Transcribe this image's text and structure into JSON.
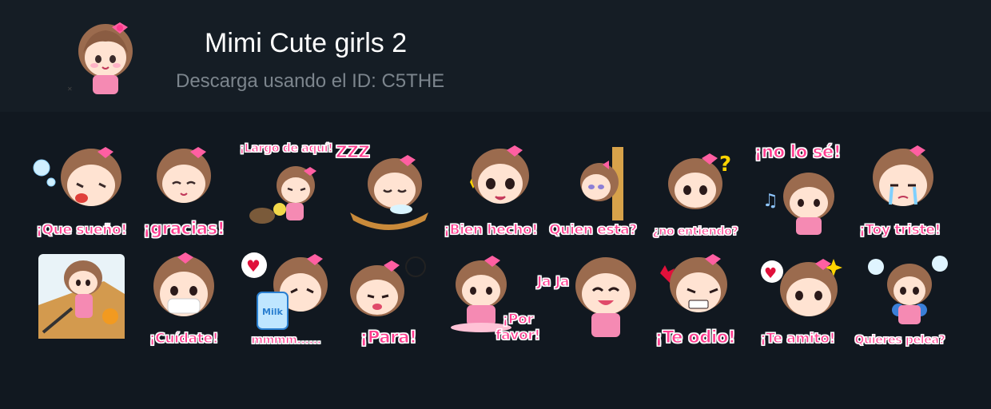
{
  "header": {
    "title": "Mimi Cute girls 2",
    "subtitle": "Descarga usando el ID: C5THE"
  },
  "colors": {
    "background": "#111820",
    "header_background": "#151d25",
    "title": "#ffffff",
    "subtitle": "#7c858d",
    "caption": "#ff3b8e",
    "hair": "#9b6b4e",
    "bow": "#ff5fa2",
    "apron": "#f58ab3"
  },
  "stickers": [
    {
      "caption": "¡Que sueño!"
    },
    {
      "caption": "¡gracias!"
    },
    {
      "caption": "¡Largo de aquí!"
    },
    {
      "caption": "ZZZ"
    },
    {
      "caption": "¡Bien hecho!"
    },
    {
      "caption": "Quien esta?"
    },
    {
      "caption": "¿no entiendo?"
    },
    {
      "caption": "¡no lo sé!"
    },
    {
      "caption": "¡Toy triste!"
    },
    {
      "caption": ""
    },
    {
      "caption": "¡Cuídate!"
    },
    {
      "caption": "mmmm......"
    },
    {
      "caption": "¡Para!"
    },
    {
      "caption": "¡Por favor!"
    },
    {
      "caption": "Ja Ja"
    },
    {
      "caption": "¡Te odio!"
    },
    {
      "caption": "¡Te amito!"
    },
    {
      "caption": "Quieres pelea?"
    }
  ]
}
